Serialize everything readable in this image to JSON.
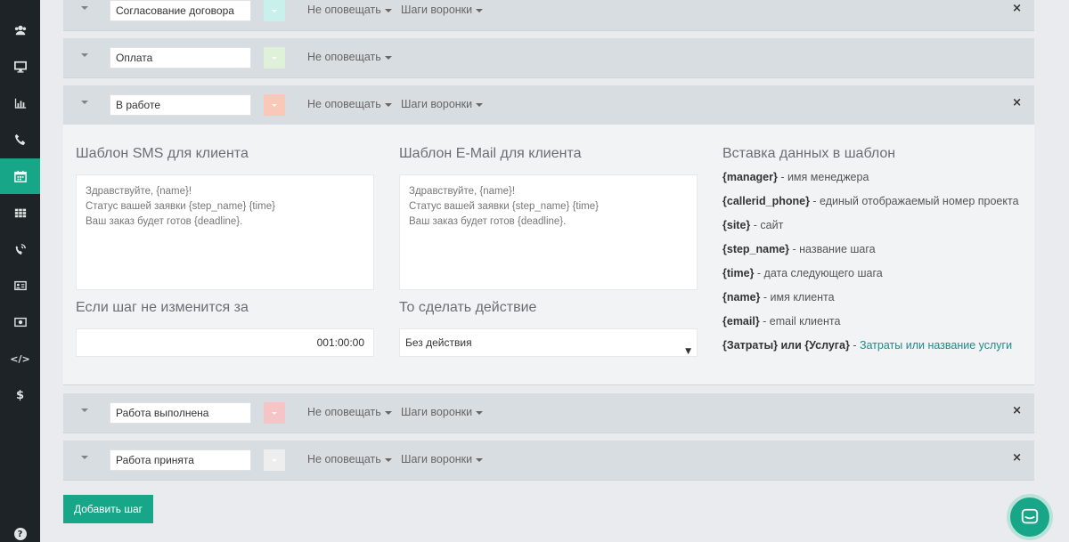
{
  "sidebar": {
    "items": [
      {
        "icon": "users-icon",
        "active": false
      },
      {
        "icon": "monitor-icon",
        "active": false
      },
      {
        "icon": "bar-chart-icon",
        "active": false
      },
      {
        "icon": "phone-icon",
        "active": false
      },
      {
        "icon": "calendar-icon",
        "active": true
      },
      {
        "icon": "table-icon",
        "active": false
      },
      {
        "icon": "phone-volume-icon",
        "active": false
      },
      {
        "icon": "id-card-icon",
        "active": false
      },
      {
        "icon": "money-icon",
        "active": false
      },
      {
        "icon": "code-icon",
        "active": false,
        "glyph": "</>"
      },
      {
        "icon": "dollar-icon",
        "active": false,
        "glyph": "$"
      },
      {
        "icon": "help-icon",
        "active": false,
        "glyph": "?"
      }
    ]
  },
  "steps": [
    {
      "name": "Согласование договора",
      "color": "#c9f0ea",
      "notify_label": "Не оповещать",
      "funnel_label": "Шаги воронки",
      "has_close": true
    },
    {
      "name": "Оплата",
      "color": "#dff1d8",
      "notify_label": "Не оповещать",
      "has_close": false
    },
    {
      "name": "В работе",
      "color": "#f9c8b8",
      "notify_label": "Не оповещать",
      "funnel_label": "Шаги воронки",
      "has_close": true
    },
    {
      "name": "Работа выполнена",
      "color": "#f5c4c4",
      "notify_label": "Не оповещать",
      "funnel_label": "Шаги воронки",
      "has_close": true
    },
    {
      "name": "Работа принята",
      "color": "#eeeeee",
      "notify_label": "Не оповещать",
      "funnel_label": "Шаги воронки",
      "has_close": true
    }
  ],
  "close_symbol": "×",
  "expanded": {
    "sms_title": "Шаблон SMS для клиента",
    "sms_text": "Здравствуйте, {name}!\nСтатус вашей заявки {step_name} {time}\nВаш заказ будет готов {deadline}.",
    "email_title": "Шаблон E-Mail для клиента",
    "email_text": "Здравствуйте, {name}!\nСтатус вашей заявки {step_name} {time}\nВаш заказ будет готов {deadline}.",
    "timeout_title": "Если шаг не изменится за",
    "timeout_value": "001:00:00",
    "action_title": "То сделать действие",
    "action_value": "Без действия",
    "vars_title": "Вставка данных в шаблон",
    "vars": [
      {
        "key": "{manager}",
        "desc": " - имя менеджера"
      },
      {
        "key": "{callerid_phone}",
        "desc": " - единый отображаемый номер проекта"
      },
      {
        "key": "{site}",
        "desc": " - сайт"
      },
      {
        "key": "{step_name}",
        "desc": " - название шага"
      },
      {
        "key": "{time}",
        "desc": " - дата следующего шага"
      },
      {
        "key": "{name}",
        "desc": " - имя клиента"
      },
      {
        "key": "{email}",
        "desc": " - email клиента"
      },
      {
        "key": "{Затраты} или {Услуга}",
        "desc": " - ",
        "link": "Затраты или название услуги"
      }
    ]
  },
  "add_step_label": "Добавить шаг",
  "chat_icon": "chat-icon"
}
